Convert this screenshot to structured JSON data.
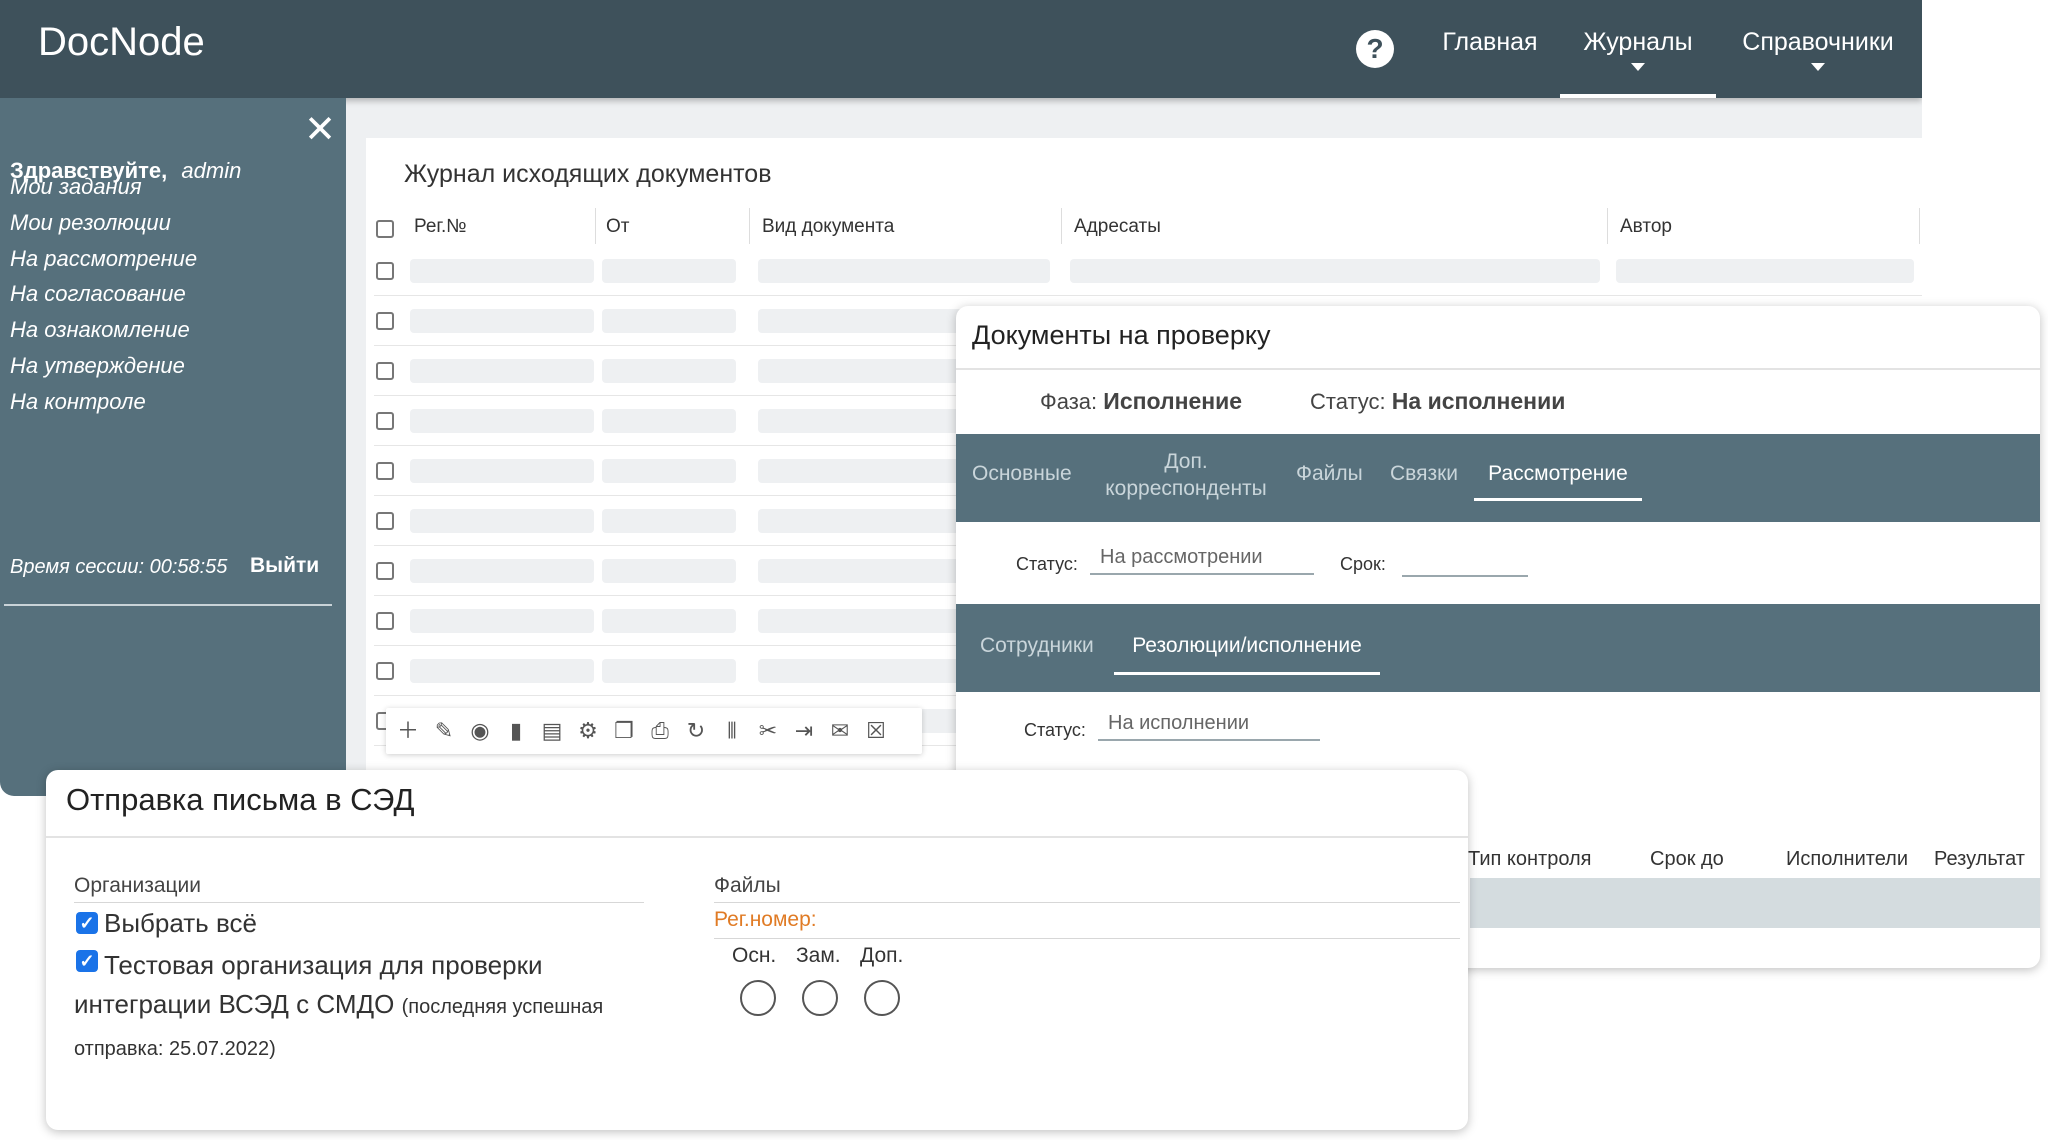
{
  "app": {
    "logo": "DocNode",
    "nav": {
      "home": "Главная",
      "journals": "Журналы",
      "references": "Справочники"
    }
  },
  "sidebar": {
    "greeting": "Здравствуйте,",
    "user": "admin",
    "items": [
      {
        "label": "Мои задания"
      },
      {
        "label": "Мои резолюции"
      },
      {
        "label": "На рассмотрение"
      },
      {
        "label": "На согласование"
      },
      {
        "label": "На ознакомление"
      },
      {
        "label": "На утверждение"
      },
      {
        "label": "На контроле"
      }
    ],
    "session_label": "Время сессии: 00:58:55",
    "logout": "Выйти"
  },
  "journal": {
    "title": "Журнал исходящих документов",
    "columns": [
      "Рег.№",
      "От",
      "Вид документа",
      "Адресаты",
      "Автор"
    ]
  },
  "review": {
    "title": "Документы на проверку",
    "phase_label": "Фаза:",
    "phase_value": "Исполнение",
    "status_label": "Статус:",
    "status_value": "На исполнении",
    "tabs": [
      "Основные",
      "Доп.\nкорреспонденты",
      "Файлы",
      "Связки",
      "Рассмотрение"
    ],
    "review_status_label": "Статус:",
    "review_status_value": "На рассмотрении",
    "deadline_label": "Срок:",
    "subtabs": [
      "Сотрудники",
      "Резолюции/исполнение"
    ],
    "exec_status_label": "Статус:",
    "exec_status_value": "На исполнении",
    "control_columns": [
      "Тип контроля",
      "Срок до",
      "Исполнители",
      "Результат"
    ]
  },
  "send_dialog": {
    "title": "Отправка письма в СЭД",
    "orgs_header": "Организации",
    "select_all": "Выбрать всё",
    "org_name": "Тестовая организация для проверки интеграции ВСЭД с СМДО",
    "org_note": "(последняя успешная отправка: 25.07.2022)",
    "files_header": "Файлы",
    "reg_number_label": "Рег.номер:",
    "file_types": [
      "Осн.",
      "Зам.",
      "Доп."
    ]
  }
}
